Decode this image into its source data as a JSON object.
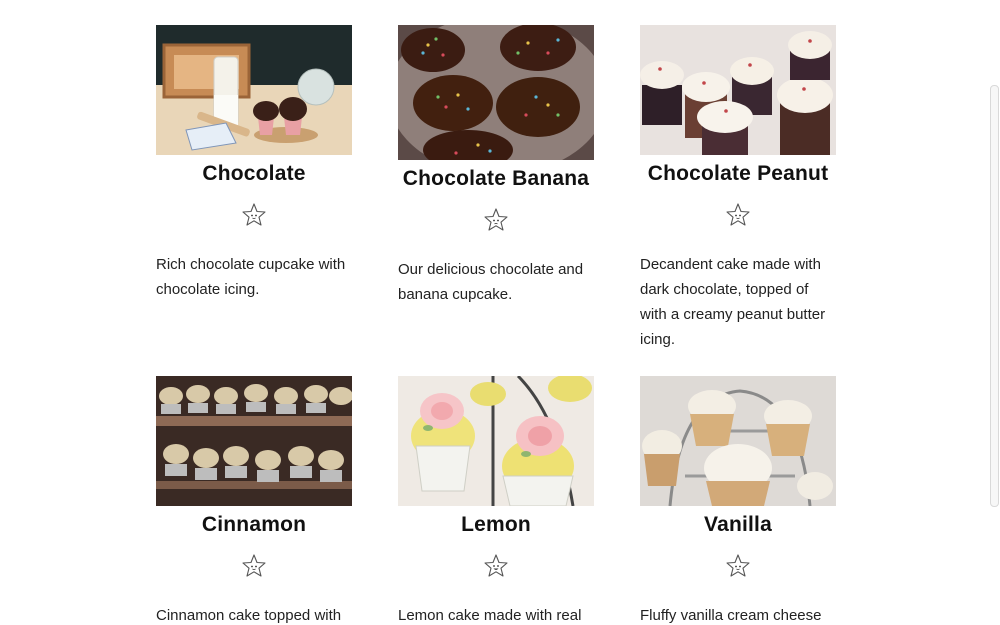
{
  "cupcakes": [
    {
      "name": "Chocolate",
      "description": "Rich chocolate cupcake with chocolate icing.",
      "rating_icon": "star-face-icon"
    },
    {
      "name": "Chocolate Banana",
      "description": "Our delicious chocolate and banana cupcake.",
      "rating_icon": "star-face-icon"
    },
    {
      "name": "Chocolate Peanut",
      "description": "Decandent cake made with dark chocolate, topped of with a creamy peanut butter icing.",
      "rating_icon": "star-face-icon"
    },
    {
      "name": "Cinnamon",
      "description": "Cinnamon cake topped with",
      "rating_icon": "star-face-icon"
    },
    {
      "name": "Lemon",
      "description": "Lemon cake made with real",
      "rating_icon": "star-face-icon"
    },
    {
      "name": "Vanilla",
      "description": "Fluffy vanilla cream cheese",
      "rating_icon": "star-face-icon"
    }
  ],
  "colors": {
    "text": "#111111",
    "background": "#ffffff"
  }
}
